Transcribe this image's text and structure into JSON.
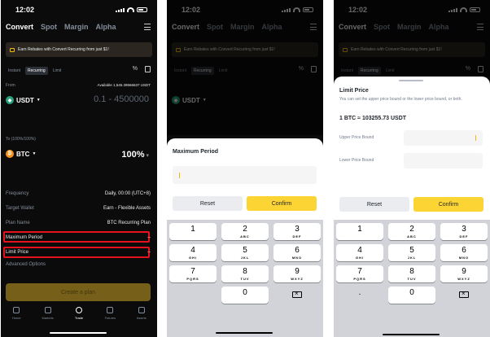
{
  "status": {
    "time": "12:02"
  },
  "tabs": [
    "Convert",
    "Spot",
    "Margin",
    "Alpha"
  ],
  "banner": "Earn Rebates with Convert Recurring from just $1!",
  "segments": [
    "Instant",
    "Recurring",
    "Limit"
  ],
  "icons": {
    "convert": "percent-icon",
    "history": "history-icon",
    "menu": "menu-icon"
  },
  "from": {
    "label": "From",
    "available": "Available 1,545.39566637 USDT",
    "coin": "USDT",
    "placeholder": "0.1 - 4500000"
  },
  "to": {
    "label": "To (100%/100%)",
    "coin": "BTC",
    "percent": "100%"
  },
  "settings": [
    {
      "key": "Frequency",
      "value": "Daily, 00:00 (UTC+8)"
    },
    {
      "key": "Target Wallet",
      "value": "Earn - Flexible Assets"
    },
    {
      "key": "Plan Name",
      "value": "BTC Recurring Plan"
    },
    {
      "key": "Maximum Period",
      "value": "--"
    },
    {
      "key": "Limit Price",
      "value": "--"
    }
  ],
  "advanced": "Advanced Options",
  "create_button": "Create a plan",
  "nav": [
    "Home",
    "Markets",
    "Trade",
    "Futures",
    "Assets"
  ],
  "sheet_period": {
    "title": "Maximum Period",
    "reset": "Reset",
    "confirm": "Confirm"
  },
  "sheet_limit": {
    "title": "Limit Price",
    "desc": "You can set the upper price bound or the lower price bound, or both.",
    "rate": "1 BTC ≈ 103255.73 USDT",
    "upper": "Upper Price Bound",
    "lower": "Lower Price Bound",
    "reset": "Reset",
    "confirm": "Confirm"
  },
  "keypad": [
    {
      "n": "1",
      "s": ""
    },
    {
      "n": "2",
      "s": "ABC"
    },
    {
      "n": "3",
      "s": "DEF"
    },
    {
      "n": "4",
      "s": "GHI"
    },
    {
      "n": "5",
      "s": "JKL"
    },
    {
      "n": "6",
      "s": "MNO"
    },
    {
      "n": "7",
      "s": "PQRS"
    },
    {
      "n": "8",
      "s": "TUV"
    },
    {
      "n": "9",
      "s": "WXYZ"
    },
    {
      "n": "0",
      "s": ""
    }
  ],
  "keypad_decimal": ".",
  "colors": {
    "accent": "#fcd535",
    "highlight": "#e5121d",
    "bg": "#0b0b0b"
  }
}
